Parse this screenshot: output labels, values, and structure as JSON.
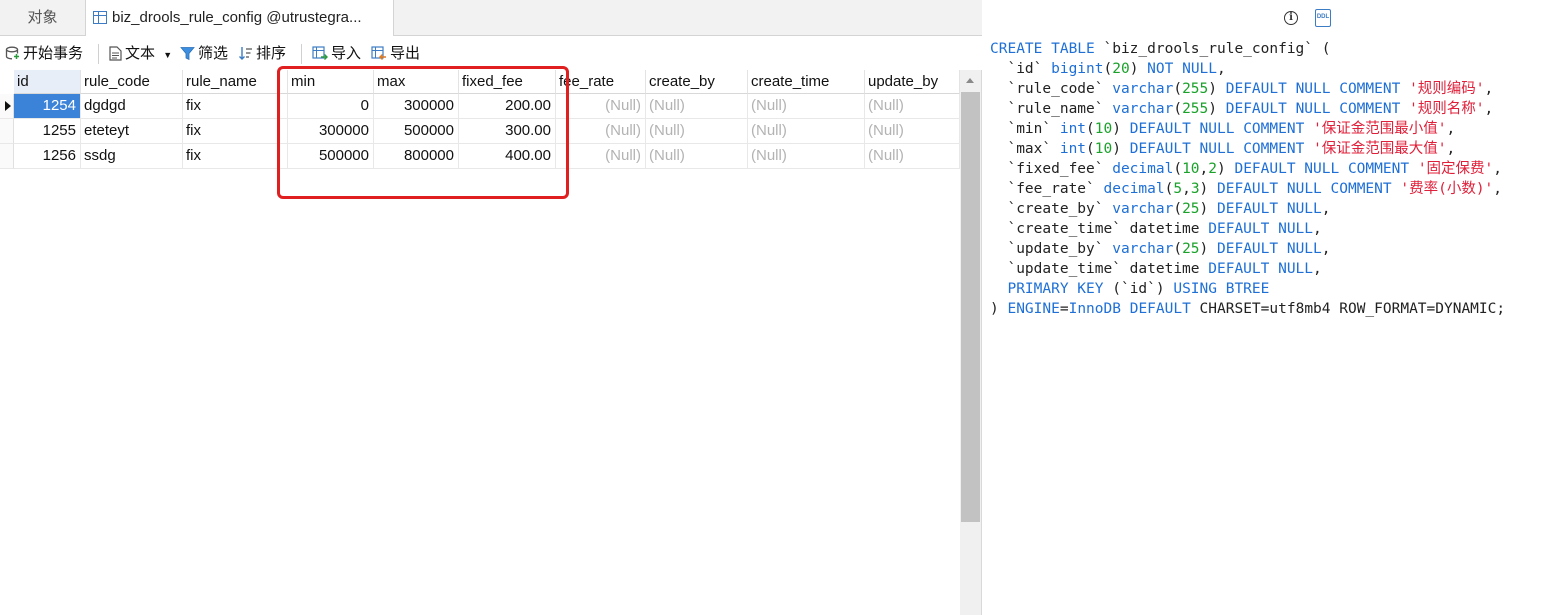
{
  "tabs": {
    "objects": "对象",
    "table": "biz_drools_rule_config @utrustegra..."
  },
  "toolbar": {
    "begin_transaction": "开始事务",
    "text": "文本",
    "filter": "筛选",
    "sort": "排序",
    "import": "导入",
    "export": "导出"
  },
  "grid": {
    "columns": [
      "id",
      "rule_code",
      "rule_name",
      "min",
      "max",
      "fixed_fee",
      "fee_rate",
      "create_by",
      "create_time",
      "update_by"
    ],
    "rows": [
      [
        "1254",
        "dgdgd",
        "fix",
        "0",
        "300000",
        "200.00",
        "(Null)",
        "(Null)",
        "(Null)",
        "(Null)"
      ],
      [
        "1255",
        "eteteyt",
        "fix",
        "300000",
        "500000",
        "300.00",
        "(Null)",
        "(Null)",
        "(Null)",
        "(Null)"
      ],
      [
        "1256",
        "ssdg",
        "fix",
        "500000",
        "800000",
        "400.00",
        "(Null)",
        "(Null)",
        "(Null)",
        "(Null)"
      ]
    ],
    "selected_row": 0,
    "highlight_color": "#e02020",
    "selection_color": "#3b83d9"
  },
  "ddl": {
    "lines": [
      [
        [
          "kw",
          "CREATE TABLE"
        ],
        [
          "t",
          " `biz_drools_rule_config` ("
        ]
      ],
      [
        [
          "t",
          "  `id` "
        ],
        [
          "kw",
          "bigint"
        ],
        [
          "t",
          "("
        ],
        [
          "nm",
          "20"
        ],
        [
          "t",
          ") "
        ],
        [
          "kw",
          "NOT NULL"
        ],
        [
          "t",
          ","
        ]
      ],
      [
        [
          "t",
          "  `rule_code` "
        ],
        [
          "kw",
          "varchar"
        ],
        [
          "t",
          "("
        ],
        [
          "nm",
          "255"
        ],
        [
          "t",
          ") "
        ],
        [
          "kw",
          "DEFAULT NULL COMMENT"
        ],
        [
          "t",
          " "
        ],
        [
          "st",
          "'规则编码'"
        ],
        [
          "t",
          ","
        ]
      ],
      [
        [
          "t",
          "  `rule_name` "
        ],
        [
          "kw",
          "varchar"
        ],
        [
          "t",
          "("
        ],
        [
          "nm",
          "255"
        ],
        [
          "t",
          ") "
        ],
        [
          "kw",
          "DEFAULT NULL COMMENT"
        ],
        [
          "t",
          " "
        ],
        [
          "st",
          "'规则名称'"
        ],
        [
          "t",
          ","
        ]
      ],
      [
        [
          "t",
          "  `min` "
        ],
        [
          "kw",
          "int"
        ],
        [
          "t",
          "("
        ],
        [
          "nm",
          "10"
        ],
        [
          "t",
          ") "
        ],
        [
          "kw",
          "DEFAULT NULL COMMENT"
        ],
        [
          "t",
          " "
        ],
        [
          "st",
          "'保证金范围最小值'"
        ],
        [
          "t",
          ","
        ]
      ],
      [
        [
          "t",
          "  `max` "
        ],
        [
          "kw",
          "int"
        ],
        [
          "t",
          "("
        ],
        [
          "nm",
          "10"
        ],
        [
          "t",
          ") "
        ],
        [
          "kw",
          "DEFAULT NULL COMMENT"
        ],
        [
          "t",
          " "
        ],
        [
          "st",
          "'保证金范围最大值'"
        ],
        [
          "t",
          ","
        ]
      ],
      [
        [
          "t",
          "  `fixed_fee` "
        ],
        [
          "kw",
          "decimal"
        ],
        [
          "t",
          "("
        ],
        [
          "nm",
          "10"
        ],
        [
          "t",
          ","
        ],
        [
          "nm",
          "2"
        ],
        [
          "t",
          ") "
        ],
        [
          "kw",
          "DEFAULT NULL COMMENT"
        ],
        [
          "t",
          " "
        ],
        [
          "st",
          "'固定保费'"
        ],
        [
          "t",
          ","
        ]
      ],
      [
        [
          "t",
          "  `fee_rate` "
        ],
        [
          "kw",
          "decimal"
        ],
        [
          "t",
          "("
        ],
        [
          "nm",
          "5"
        ],
        [
          "t",
          ","
        ],
        [
          "nm",
          "3"
        ],
        [
          "t",
          ") "
        ],
        [
          "kw",
          "DEFAULT NULL COMMENT"
        ],
        [
          "t",
          " "
        ],
        [
          "st",
          "'费率(小数)'"
        ],
        [
          "t",
          ","
        ]
      ],
      [
        [
          "t",
          "  `create_by` "
        ],
        [
          "kw",
          "varchar"
        ],
        [
          "t",
          "("
        ],
        [
          "nm",
          "25"
        ],
        [
          "t",
          ") "
        ],
        [
          "kw",
          "DEFAULT NULL"
        ],
        [
          "t",
          ","
        ]
      ],
      [
        [
          "t",
          "  `create_time` datetime "
        ],
        [
          "kw",
          "DEFAULT NULL"
        ],
        [
          "t",
          ","
        ]
      ],
      [
        [
          "t",
          "  `update_by` "
        ],
        [
          "kw",
          "varchar"
        ],
        [
          "t",
          "("
        ],
        [
          "nm",
          "25"
        ],
        [
          "t",
          ") "
        ],
        [
          "kw",
          "DEFAULT NULL"
        ],
        [
          "t",
          ","
        ]
      ],
      [
        [
          "t",
          "  `update_time` datetime "
        ],
        [
          "kw",
          "DEFAULT NULL"
        ],
        [
          "t",
          ","
        ]
      ],
      [
        [
          "kw",
          "  PRIMARY KEY"
        ],
        [
          "t",
          " (`id`) "
        ],
        [
          "kw",
          "USING BTREE"
        ]
      ],
      [
        [
          "t",
          ") "
        ],
        [
          "kw",
          "ENGINE"
        ],
        [
          "t",
          "="
        ],
        [
          "kw",
          "InnoDB"
        ],
        [
          "t",
          " "
        ],
        [
          "kw",
          "DEFAULT"
        ],
        [
          "t",
          " CHARSET=utf8mb4 ROW_FORMAT=DYNAMIC;"
        ]
      ]
    ]
  },
  "icons": {
    "info": "i",
    "ddl": "DDL"
  },
  "colors": {
    "keyword": "#1e6fd6",
    "number": "#1aa12a",
    "string": "#e0203a"
  }
}
